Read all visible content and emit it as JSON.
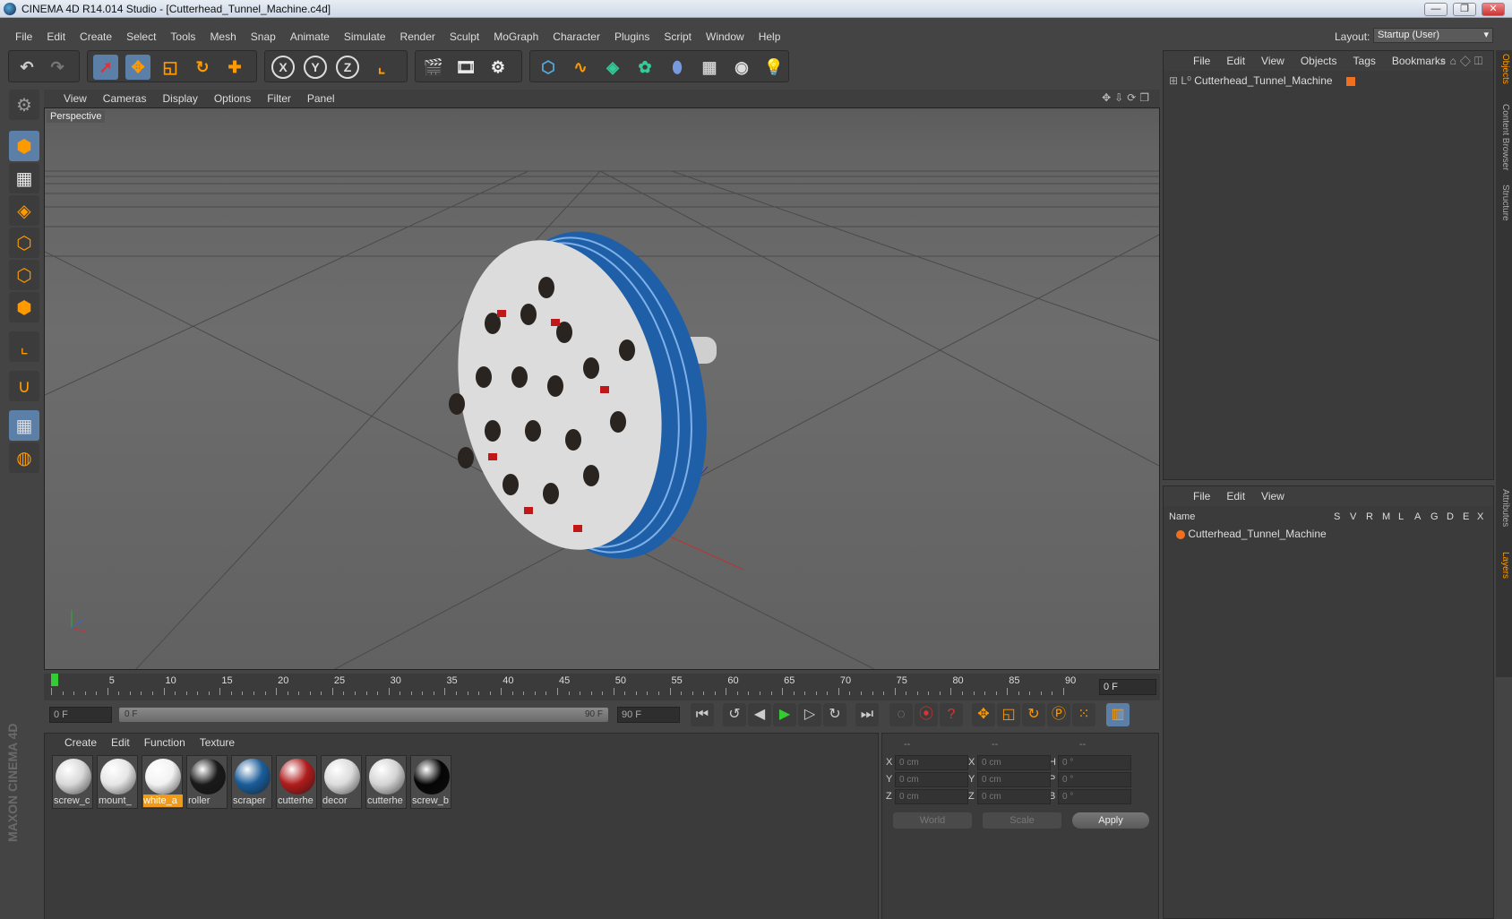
{
  "window": {
    "title": "CINEMA 4D R14.014 Studio - [Cutterhead_Tunnel_Machine.c4d]",
    "min": "—",
    "max": "❐",
    "close": "✕"
  },
  "menubar": [
    "File",
    "Edit",
    "Create",
    "Select",
    "Tools",
    "Mesh",
    "Snap",
    "Animate",
    "Simulate",
    "Render",
    "Sculpt",
    "MoGraph",
    "Character",
    "Plugins",
    "Script",
    "Window",
    "Help"
  ],
  "layout": {
    "label": "Layout:",
    "value": "Startup (User)"
  },
  "viewport": {
    "menu": [
      "View",
      "Cameras",
      "Display",
      "Options",
      "Filter",
      "Panel"
    ],
    "label": "Perspective"
  },
  "timeline": {
    "ticks": [
      "0",
      "5",
      "10",
      "15",
      "20",
      "25",
      "30",
      "35",
      "40",
      "45",
      "50",
      "55",
      "60",
      "65",
      "70",
      "75",
      "80",
      "85",
      "90"
    ],
    "current_frame": "0 F"
  },
  "transport": {
    "start": "0 F",
    "range_start": "0 F",
    "range_end": "90 F",
    "end": "90 F"
  },
  "materials": {
    "menu": [
      "Create",
      "Edit",
      "Function",
      "Texture"
    ],
    "items": [
      {
        "name": "screw_c",
        "color": "#d8d8d8"
      },
      {
        "name": "mount_",
        "color": "#e6e6e6"
      },
      {
        "name": "white_a",
        "color": "#f2f2f2",
        "selected": true
      },
      {
        "name": "roller",
        "color": "#1a1a1a"
      },
      {
        "name": "scraper",
        "color": "#1b5d9a"
      },
      {
        "name": "cutterhe",
        "color": "#b01c1c"
      },
      {
        "name": "decor",
        "color": "#dcdcdc"
      },
      {
        "name": "cutterhe",
        "color": "#d4d4d4"
      },
      {
        "name": "screw_b",
        "color": "#050505"
      }
    ]
  },
  "coords": {
    "headers": [
      "--",
      "--",
      "--"
    ],
    "rows": [
      {
        "a": "X",
        "v1": "0 cm",
        "b": "X",
        "v2": "0 cm",
        "c": "H",
        "v3": "0 °"
      },
      {
        "a": "Y",
        "v1": "0 cm",
        "b": "Y",
        "v2": "0 cm",
        "c": "P",
        "v3": "0 °"
      },
      {
        "a": "Z",
        "v1": "0 cm",
        "b": "Z",
        "v2": "0 cm",
        "c": "B",
        "v3": "0 °"
      }
    ],
    "space": "World",
    "mode": "Scale",
    "apply": "Apply"
  },
  "objects": {
    "menu": [
      "File",
      "Edit",
      "View",
      "Objects",
      "Tags",
      "Bookmarks"
    ],
    "root": "Cutterhead_Tunnel_Machine"
  },
  "layers": {
    "menu": [
      "File",
      "Edit",
      "View"
    ],
    "columns": [
      "Name",
      "S",
      "V",
      "R",
      "M",
      "L",
      "A",
      "G",
      "D",
      "E",
      "X"
    ],
    "row": "Cutterhead_Tunnel_Machine"
  },
  "sidetabs": [
    "Objects",
    "Content Browser",
    "Structure",
    "Attributes",
    "Layers"
  ],
  "brand": {
    "logo": "MAXON CINEMA 4D"
  },
  "colors": {
    "accent": "#f09a1a",
    "selected": "#5c7fa8",
    "cutter_blue": "#1f5fa8"
  }
}
